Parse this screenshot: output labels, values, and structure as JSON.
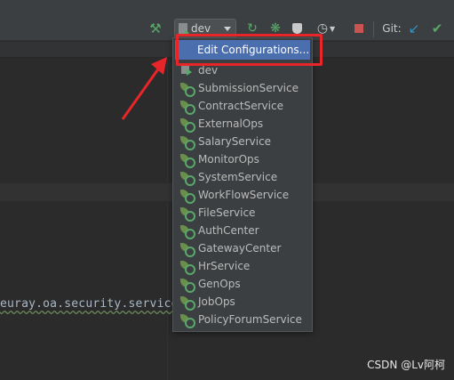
{
  "toolbar": {
    "config_label": "dev",
    "git_label": "Git:",
    "icons": [
      "hammer-icon",
      "run-icon",
      "debug-icon",
      "coverage-icon",
      "profile-icon",
      "stop-icon",
      "update-icon",
      "commit-icon"
    ]
  },
  "editor": {
    "code_line": "euray.oa.security.service"
  },
  "popup": {
    "edit_configurations": "Edit Configurations...",
    "items": [
      {
        "label": "dev",
        "icon": "dev-config-icon"
      },
      {
        "label": "SubmissionService",
        "icon": "spring-boot-icon"
      },
      {
        "label": "ContractService",
        "icon": "spring-boot-icon"
      },
      {
        "label": "ExternalOps",
        "icon": "spring-boot-icon"
      },
      {
        "label": "SalaryService",
        "icon": "spring-boot-icon"
      },
      {
        "label": "MonitorOps",
        "icon": "spring-boot-icon"
      },
      {
        "label": "SystemService",
        "icon": "spring-boot-icon"
      },
      {
        "label": "WorkFlowService",
        "icon": "spring-boot-icon"
      },
      {
        "label": "FileService",
        "icon": "spring-boot-icon"
      },
      {
        "label": "AuthCenter",
        "icon": "spring-boot-icon"
      },
      {
        "label": "GatewayCenter",
        "icon": "spring-boot-icon"
      },
      {
        "label": "HrService",
        "icon": "spring-boot-icon"
      },
      {
        "label": "GenOps",
        "icon": "spring-boot-icon"
      },
      {
        "label": "JobOps",
        "icon": "spring-boot-icon"
      },
      {
        "label": "PolicyForumService",
        "icon": "spring-boot-icon"
      }
    ]
  },
  "watermark": "CSDN @Lv阿柯",
  "colors": {
    "selection": "#4b6eaf",
    "annotation_red": "#e8262a",
    "run_green": "#59a869"
  }
}
